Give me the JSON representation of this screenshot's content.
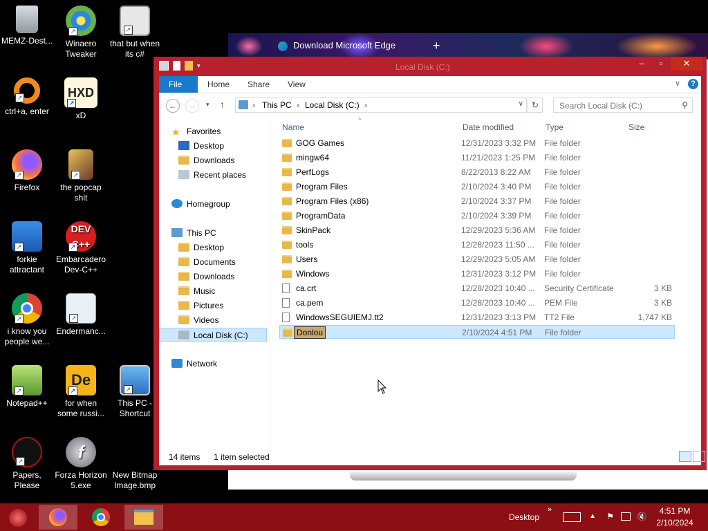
{
  "desktop": {
    "icons": [
      {
        "label": "MEMZ-Dest..."
      },
      {
        "label": "Winaero Tweaker"
      },
      {
        "label": "that but when its c#"
      },
      {
        "label": "ctrl+a, enter"
      },
      {
        "label": "xD"
      },
      {
        "label": "Firefox"
      },
      {
        "label": "the popcap shit"
      },
      {
        "label": "forkie attractant"
      },
      {
        "label": "Embarcadero Dev-C++"
      },
      {
        "label": "i know you people we..."
      },
      {
        "label": "Endermanc..."
      },
      {
        "label": "Notepad++"
      },
      {
        "label": "for when some russi..."
      },
      {
        "label": "This PC - Shortcut"
      },
      {
        "label": "Papers, Please"
      },
      {
        "label": "Forza Horizon 5.exe"
      },
      {
        "label": "New Bitmap Image.bmp"
      }
    ]
  },
  "browser": {
    "tab_title": "Download Microsoft Edge"
  },
  "explorer": {
    "title": "Local Disk (C:)",
    "ribbon": {
      "file": "File",
      "home": "Home",
      "share": "Share",
      "view": "View"
    },
    "address": {
      "this_pc": "This PC",
      "drive": "Local Disk (C:)"
    },
    "search_placeholder": "Search Local Disk (C:)",
    "nav": {
      "favorites": "Favorites",
      "fav_desktop": "Desktop",
      "fav_downloads": "Downloads",
      "fav_recent": "Recent places",
      "homegroup": "Homegroup",
      "this_pc": "This PC",
      "pc_desktop": "Desktop",
      "pc_documents": "Documents",
      "pc_downloads": "Downloads",
      "pc_music": "Music",
      "pc_pictures": "Pictures",
      "pc_videos": "Videos",
      "pc_local_disk": "Local Disk (C:)",
      "network": "Network"
    },
    "columns": {
      "name": "Name",
      "date": "Date modified",
      "type": "Type",
      "size": "Size"
    },
    "files": [
      {
        "name": "GOG Games",
        "date": "12/31/2023 3:32 PM",
        "type": "File folder",
        "size": ""
      },
      {
        "name": "mingw64",
        "date": "11/21/2023 1:25 PM",
        "type": "File folder",
        "size": ""
      },
      {
        "name": "PerfLogs",
        "date": "8/22/2013 8:22 AM",
        "type": "File folder",
        "size": ""
      },
      {
        "name": "Program Files",
        "date": "2/10/2024 3:40 PM",
        "type": "File folder",
        "size": ""
      },
      {
        "name": "Program Files (x86)",
        "date": "2/10/2024 3:37 PM",
        "type": "File folder",
        "size": ""
      },
      {
        "name": "ProgramData",
        "date": "2/10/2024 3:39 PM",
        "type": "File folder",
        "size": ""
      },
      {
        "name": "SkinPack",
        "date": "12/29/2023 5:36 AM",
        "type": "File folder",
        "size": ""
      },
      {
        "name": "tools",
        "date": "12/28/2023 11:50 ...",
        "type": "File folder",
        "size": ""
      },
      {
        "name": "Users",
        "date": "12/29/2023 5:05 AM",
        "type": "File folder",
        "size": ""
      },
      {
        "name": "Windows",
        "date": "12/31/2023 3:12 PM",
        "type": "File folder",
        "size": ""
      },
      {
        "name": "ca.crt",
        "date": "12/28/2023 10:40 ...",
        "type": "Security Certificate",
        "size": "3 KB"
      },
      {
        "name": "ca.pem",
        "date": "12/28/2023 10:40 ...",
        "type": "PEM File",
        "size": "3 KB"
      },
      {
        "name": "WindowsSEGUIEMJ.tt2",
        "date": "12/31/2023 3:13 PM",
        "type": "TT2 File",
        "size": "1,747 KB"
      },
      {
        "name": "Donlou",
        "date": "2/10/2024 4:51 PM",
        "type": "File folder",
        "size": ""
      }
    ],
    "status": {
      "count": "14 items",
      "selected": "1 item selected"
    }
  },
  "taskbar": {
    "desktop_label": "Desktop",
    "time": "4:51 PM",
    "date": "2/10/2024"
  }
}
